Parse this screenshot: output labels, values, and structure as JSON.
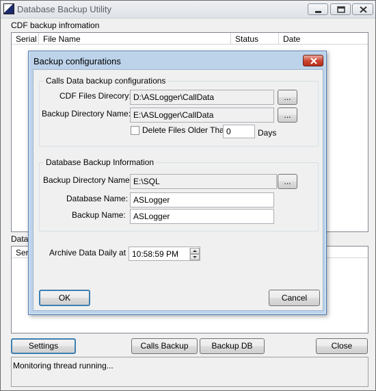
{
  "window": {
    "title": "Database Backup Utility",
    "controls": {
      "minimize": "minimize-icon",
      "maximize": "maximize-icon",
      "close": "close-icon"
    }
  },
  "cdf_section": {
    "label": "CDF backup infromation",
    "columns": [
      "Serial",
      "File Name",
      "Status",
      "Date"
    ]
  },
  "db_section": {
    "label_visible": "Datab",
    "column_visible": "Seri"
  },
  "buttons": {
    "settings": "Settings",
    "calls_backup": "Calls Backup",
    "backup_db": "Backup DB",
    "close": "Close"
  },
  "status": {
    "text": "Monitoring thread running..."
  },
  "dialog": {
    "title": "Backup configurations",
    "calls_group": {
      "title": "Calls Data backup configurations",
      "cdf_dir_label": "CDF Files Direcory:",
      "cdf_dir_value": "D:\\ASLogger\\CallData",
      "backup_dir_label": "Backup Directory Name:",
      "backup_dir_value": "E:\\ASLogger\\CallData",
      "browse_label": "...",
      "delete_label": "Delete Files Older Than",
      "delete_checked": false,
      "days_value": "0",
      "days_label": "Days"
    },
    "db_group": {
      "title": "Database Backup Information",
      "backup_dir_label": "Backup Directory Name:",
      "backup_dir_value": "E:\\SQL",
      "browse_label": "...",
      "db_name_label": "Database Name:",
      "db_name_value": "ASLogger",
      "backup_name_label": "Backup Name:",
      "backup_name_value": "ASLogger"
    },
    "archive": {
      "label": "Archive Data Daily at :",
      "time_value": "10:58:59 PM"
    },
    "ok_label": "OK",
    "cancel_label": "Cancel"
  }
}
